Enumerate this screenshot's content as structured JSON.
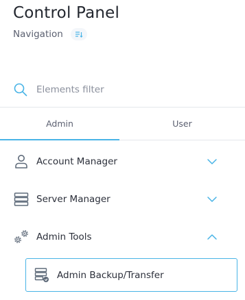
{
  "header": {
    "title": "Control Panel",
    "subtitle": "Navigation",
    "toggle_icon": "list-sort-icon"
  },
  "search": {
    "placeholder": "Elements filter",
    "value": "",
    "icon": "search-icon"
  },
  "tabs": [
    {
      "label": "Admin",
      "active": true
    },
    {
      "label": "User",
      "active": false
    }
  ],
  "menu": [
    {
      "label": "Account Manager",
      "icon": "user-icon",
      "expanded": false
    },
    {
      "label": "Server Manager",
      "icon": "server-icon",
      "expanded": false
    },
    {
      "label": "Admin Tools",
      "icon": "gears-icon",
      "expanded": true,
      "children": [
        {
          "label": "Admin Backup/Transfer",
          "icon": "server-backup-icon",
          "selected": true
        }
      ]
    }
  ],
  "colors": {
    "accent": "#47b3e6",
    "text": "#2b2f3a",
    "muted": "#5b6070",
    "icon": "#5f6b7a"
  }
}
